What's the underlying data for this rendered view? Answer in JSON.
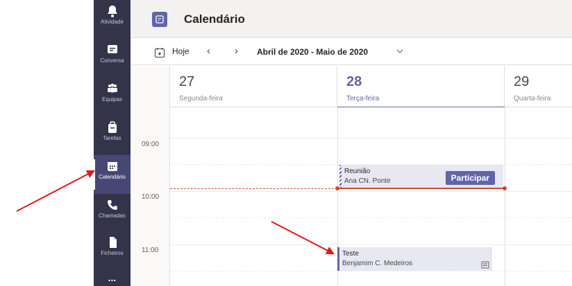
{
  "rail": {
    "items": [
      {
        "label": "Atividade",
        "icon": "bell-icon"
      },
      {
        "label": "Conversa",
        "icon": "chat-icon"
      },
      {
        "label": "Equipas",
        "icon": "teams-icon"
      },
      {
        "label": "Tarefas",
        "icon": "assignments-icon"
      },
      {
        "label": "Calendário",
        "icon": "calendar-icon",
        "active": true
      },
      {
        "label": "Chamadas",
        "icon": "phone-icon"
      },
      {
        "label": "Ficheiros",
        "icon": "file-icon"
      },
      {
        "label": "...",
        "icon": "more-icon"
      }
    ]
  },
  "header": {
    "title": "Calendário",
    "accent": "#6264a7"
  },
  "toolbar": {
    "today_label": "Hoje",
    "prev": "‹",
    "next": "›",
    "range_label": "Abril de 2020 - Maio de 2020"
  },
  "days": [
    {
      "num": "27",
      "name": "Segunda-feira"
    },
    {
      "num": "28",
      "name": "Terça-feira",
      "today": true
    },
    {
      "num": "29",
      "name": "Quarta-feira"
    }
  ],
  "times": [
    "09:00",
    "10:00",
    "11:00"
  ],
  "events": [
    {
      "title": "Reunião",
      "organizer": "Ana CN. Ponte",
      "action": "Participar"
    },
    {
      "title": "Teste",
      "organizer": "Benjamim C. Medeiros"
    }
  ],
  "colors": {
    "brand": "#6264a7",
    "now_line": "#cc4a31",
    "arrow": "#e8131b"
  }
}
